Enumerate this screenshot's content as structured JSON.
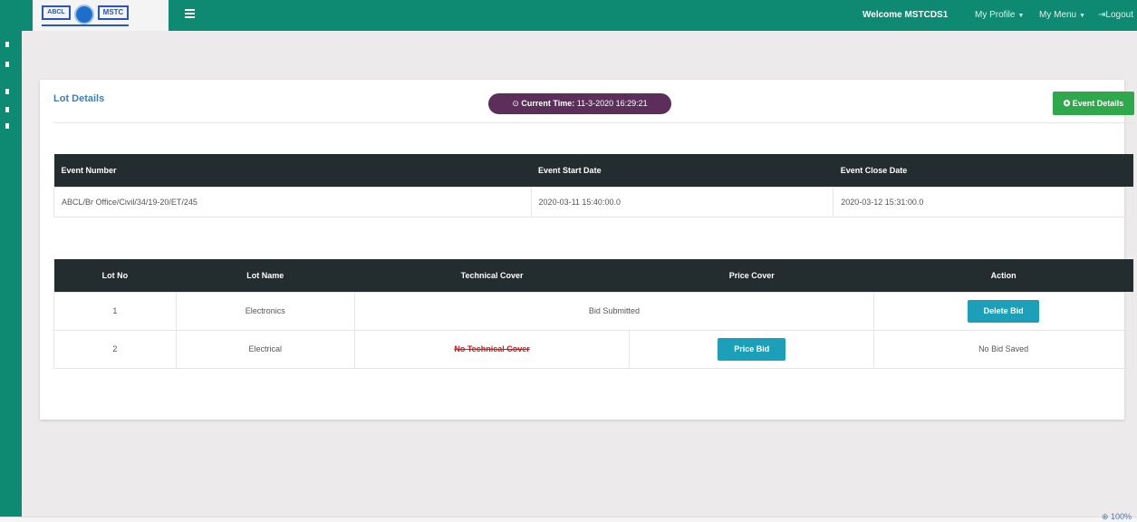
{
  "header": {
    "logo_left": "ABCL",
    "logo_right": "MSTC",
    "welcome": "Welcome MSTCDS1",
    "my_profile": "My Profile",
    "my_menu": "My Menu",
    "logout": "Logout"
  },
  "card": {
    "title": "Lot Details",
    "current_time_label": "Current Time:",
    "current_time_value": "11-3-2020 16:29:21",
    "event_details_button": "Event Details"
  },
  "event_table": {
    "headers": [
      "Event Number",
      "Event Start Date",
      "Event Close Date"
    ],
    "row": [
      "ABCL/Br Office/Civil/34/19-20/ET/245",
      "2020-03-11 15:40:00.0",
      "2020-03-12 15:31:00.0"
    ]
  },
  "lot_table": {
    "headers": [
      "Lot No",
      "Lot Name",
      "Technical Cover",
      "Price Cover",
      "Action"
    ],
    "rows": [
      {
        "lot_no": "1",
        "lot_name": "Electronics",
        "cover": "Bid Submitted",
        "action": "Delete Bid"
      },
      {
        "lot_no": "2",
        "lot_name": "Electrical",
        "technical": "No Technical Cover",
        "price": "Price Bid",
        "action": "No Bid Saved"
      }
    ]
  },
  "footer": {
    "zoom": "100%"
  },
  "colors": {
    "header_bg": "#0f8a72",
    "table_header_bg": "#232c2f",
    "time_pill_bg": "#5c2f5a",
    "event_button_bg": "#2ea84a",
    "action_button_bg": "#1c9fb9",
    "no_technical_text": "#d11a1a"
  }
}
